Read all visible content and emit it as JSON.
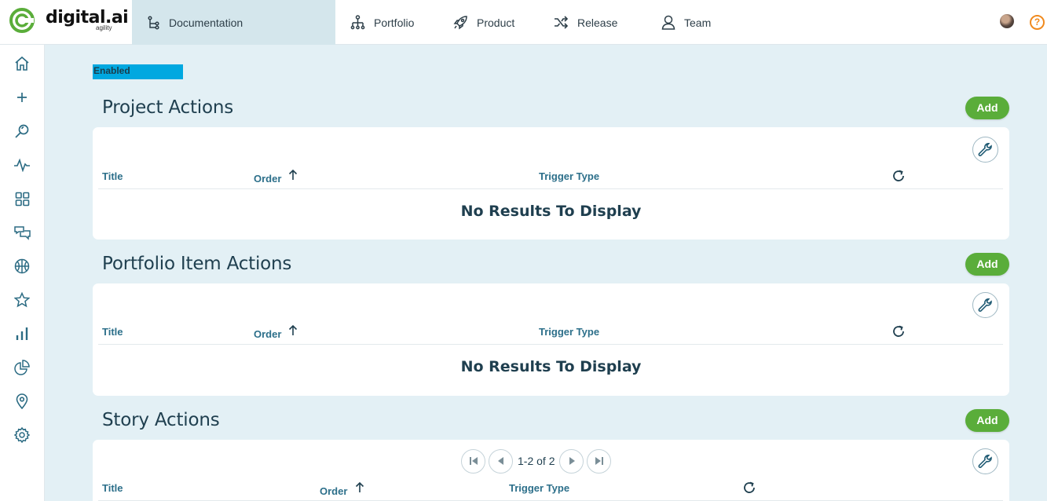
{
  "app": {
    "logo_text": "digital.ai",
    "logo_sub": "agility"
  },
  "topnav": [
    {
      "label": "Documentation",
      "icon": "hierarchy-icon",
      "active": true
    },
    {
      "label": "Portfolio",
      "icon": "org-tree-icon"
    },
    {
      "label": "Product",
      "icon": "rocket-icon"
    },
    {
      "label": "Release",
      "icon": "shuffle-icon"
    },
    {
      "label": "Team",
      "icon": "user-icon"
    }
  ],
  "sidebar": [
    "home-icon",
    "plus-icon",
    "search-icon",
    "activity-icon",
    "grid-icon",
    "chat-icon",
    "basketball-icon",
    "star-icon",
    "bar-chart-icon",
    "pie-chart-icon",
    "location-pin-icon",
    "gear-icon"
  ],
  "status_badge": "Enabled",
  "help_label": "?",
  "sections": [
    {
      "title": "Project Actions",
      "add_label": "Add",
      "columns": [
        "Title",
        "Order",
        "Trigger Type"
      ],
      "empty_text": "No Results To Display"
    },
    {
      "title": "Portfolio Item Actions",
      "add_label": "Add",
      "columns": [
        "Title",
        "Order",
        "Trigger Type"
      ],
      "empty_text": "No Results To Display"
    },
    {
      "title": "Story Actions",
      "add_label": "Add",
      "columns": [
        "Title",
        "Order",
        "Trigger Type"
      ],
      "pagination": "1-2 of 2"
    }
  ],
  "colors": {
    "accent": "#00a8e0",
    "add_button": "#5aad3a",
    "background": "#e3f0f5",
    "help": "#f08a1e"
  }
}
